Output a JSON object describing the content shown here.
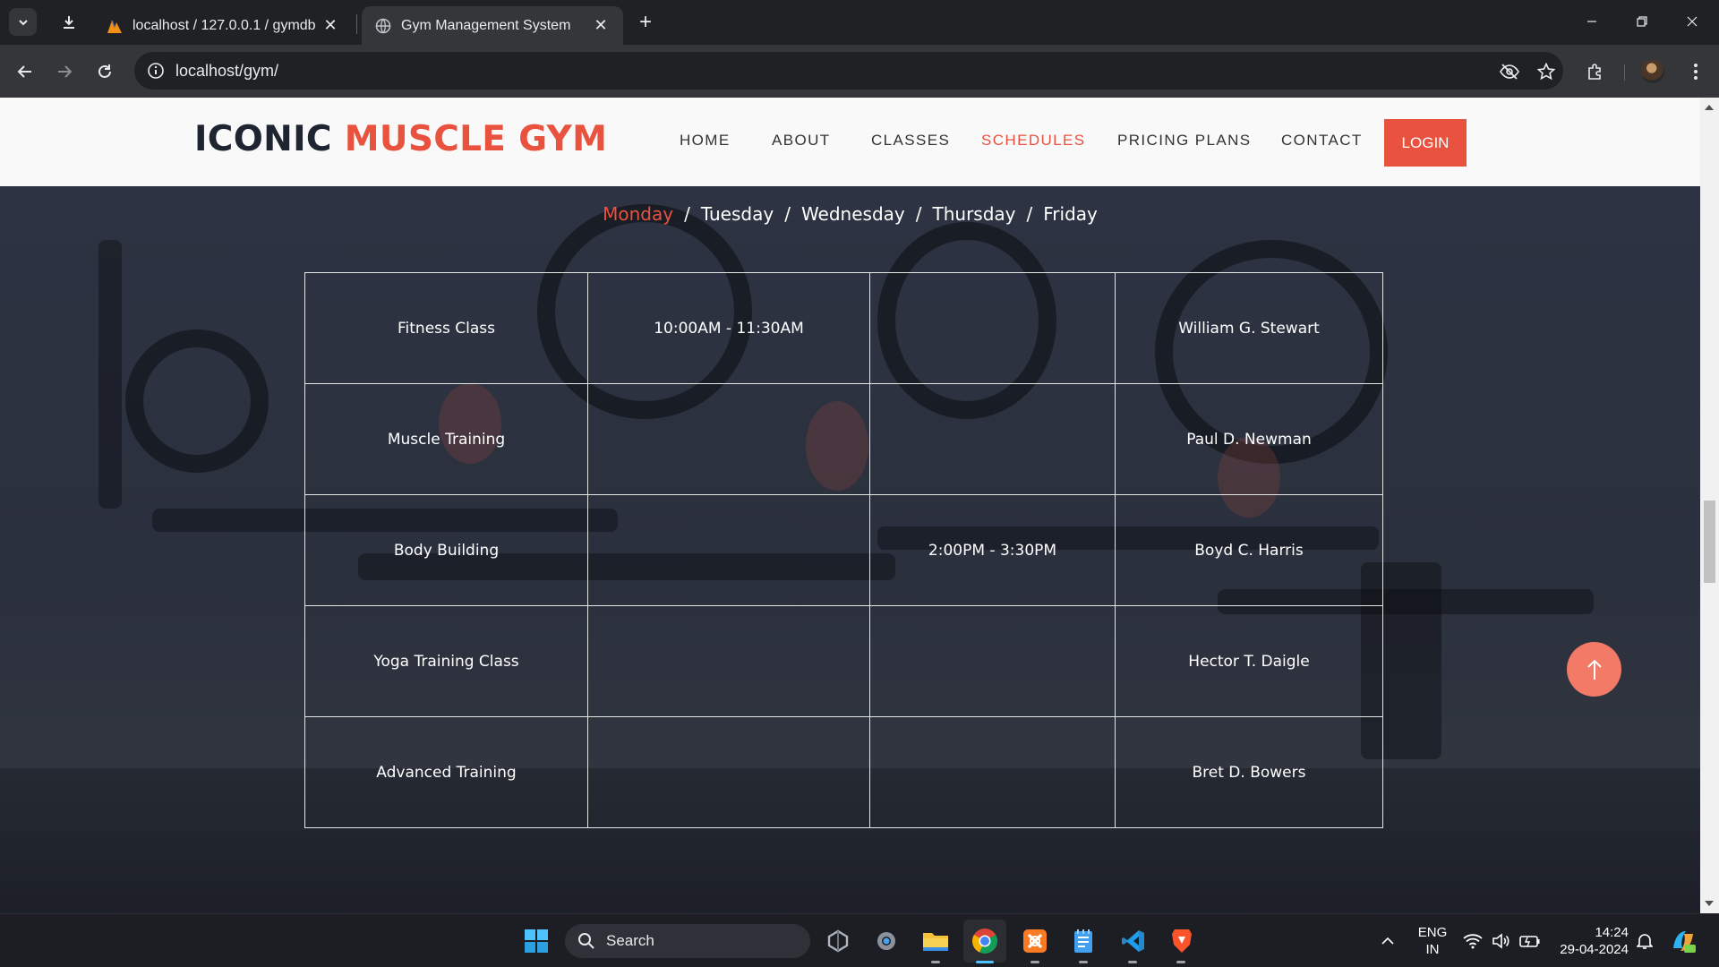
{
  "browser": {
    "tabs": [
      {
        "title": "localhost / 127.0.0.1 / gymdb | |",
        "active": false
      },
      {
        "title": "Gym Management System",
        "active": true
      }
    ],
    "url": "localhost/gym/"
  },
  "site": {
    "logo_part1": "ICONIC ",
    "logo_part2": "MUSCLE GYM",
    "nav": [
      {
        "label": "HOME"
      },
      {
        "label": "ABOUT"
      },
      {
        "label": "CLASSES"
      },
      {
        "label": "SCHEDULES",
        "active": true
      },
      {
        "label": "PRICING PLANS"
      },
      {
        "label": "CONTACT"
      }
    ],
    "login_label": "LOGIN",
    "accent_color": "#e8523f"
  },
  "schedule": {
    "days": [
      "Monday",
      "Tuesday",
      "Wednesday",
      "Thursday",
      "Friday"
    ],
    "active_day": "Monday",
    "separator": "/",
    "rows": [
      {
        "class": "Fitness Class",
        "time1": "10:00AM - 11:30AM",
        "time2": "",
        "trainer": "William G. Stewart"
      },
      {
        "class": "Muscle Training",
        "time1": "",
        "time2": "",
        "trainer": "Paul D. Newman"
      },
      {
        "class": "Body Building",
        "time1": "",
        "time2": "2:00PM - 3:30PM",
        "trainer": "Boyd C. Harris"
      },
      {
        "class": "Yoga Training Class",
        "time1": "",
        "time2": "",
        "trainer": "Hector T. Daigle"
      },
      {
        "class": "Advanced Training",
        "time1": "",
        "time2": "",
        "trainer": "Bret D. Bowers"
      }
    ]
  },
  "taskbar": {
    "search_label": "Search",
    "language": "ENG",
    "region": "IN",
    "time": "14:24",
    "date": "29-04-2024"
  }
}
